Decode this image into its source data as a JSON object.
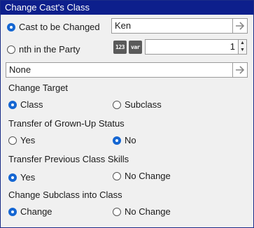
{
  "window": {
    "title": "Change Cast's Class"
  },
  "target_select": {
    "option_cast": "Cast to be Changed",
    "cast_value": "Ken",
    "option_nth": "nth in the Party",
    "nth_value": "1",
    "icons": [
      "numbers-123-icon",
      "var-icon"
    ]
  },
  "class_field": {
    "value": "None"
  },
  "change_target": {
    "heading": "Change Target",
    "options": [
      "Class",
      "Subclass"
    ],
    "selected": "Class"
  },
  "grown_up": {
    "heading": "Transfer of Grown-Up Status",
    "options": [
      "Yes",
      "No"
    ],
    "selected": "No"
  },
  "class_skills": {
    "heading": "Transfer Previous Class Skills",
    "options": [
      "Yes",
      "No Change"
    ],
    "selected": "Yes"
  },
  "subclass_into_class": {
    "heading": "Change Subclass into Class",
    "options": [
      "Change",
      "No Change"
    ],
    "selected": "Change"
  },
  "icon_text": {
    "num": "123",
    "var": "var"
  },
  "colors": {
    "title_bar": "#0d1f8c",
    "accent": "#1566d2"
  }
}
